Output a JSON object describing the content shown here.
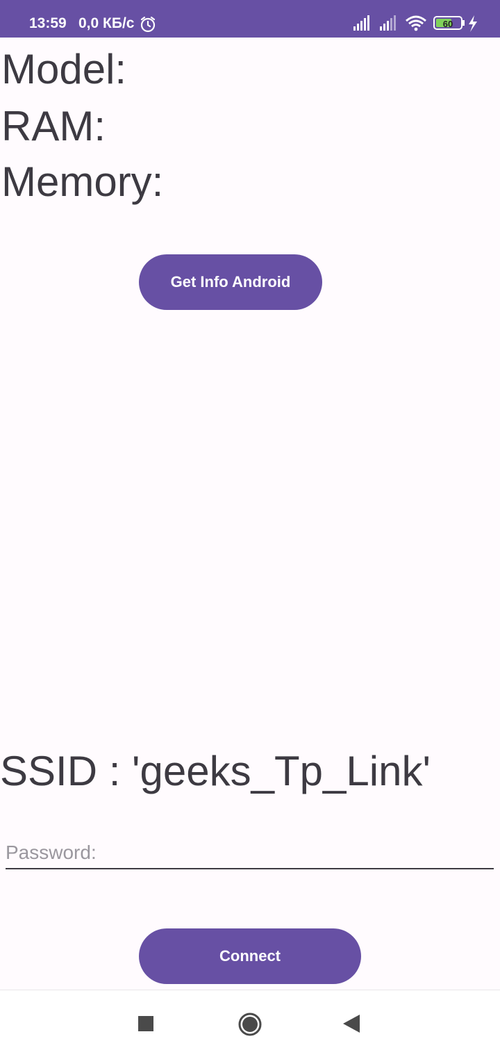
{
  "status_bar": {
    "time": "13:59",
    "network_speed": "0,0 КБ/с",
    "battery_level": "60",
    "icons": [
      "alarm-icon",
      "signal-icon",
      "signal-icon",
      "wifi-icon",
      "battery-icon",
      "charging-icon"
    ],
    "color": "#6750a4"
  },
  "device_info": {
    "model_label": "Model:",
    "ram_label": "RAM:",
    "memory_label": "Memory:"
  },
  "get_info_button": {
    "label": "Get Info Android"
  },
  "wifi": {
    "ssid_text": "SSID : 'geeks_Tp_Link'",
    "password_placeholder": "Password:",
    "password_value": ""
  },
  "connect_button": {
    "label": "Connect"
  },
  "nav_bar": {
    "icons": [
      "recents-icon",
      "home-icon",
      "back-icon"
    ]
  },
  "colors": {
    "accent": "#6750a4",
    "background": "#fffbfe",
    "text": "#3d3a42"
  }
}
